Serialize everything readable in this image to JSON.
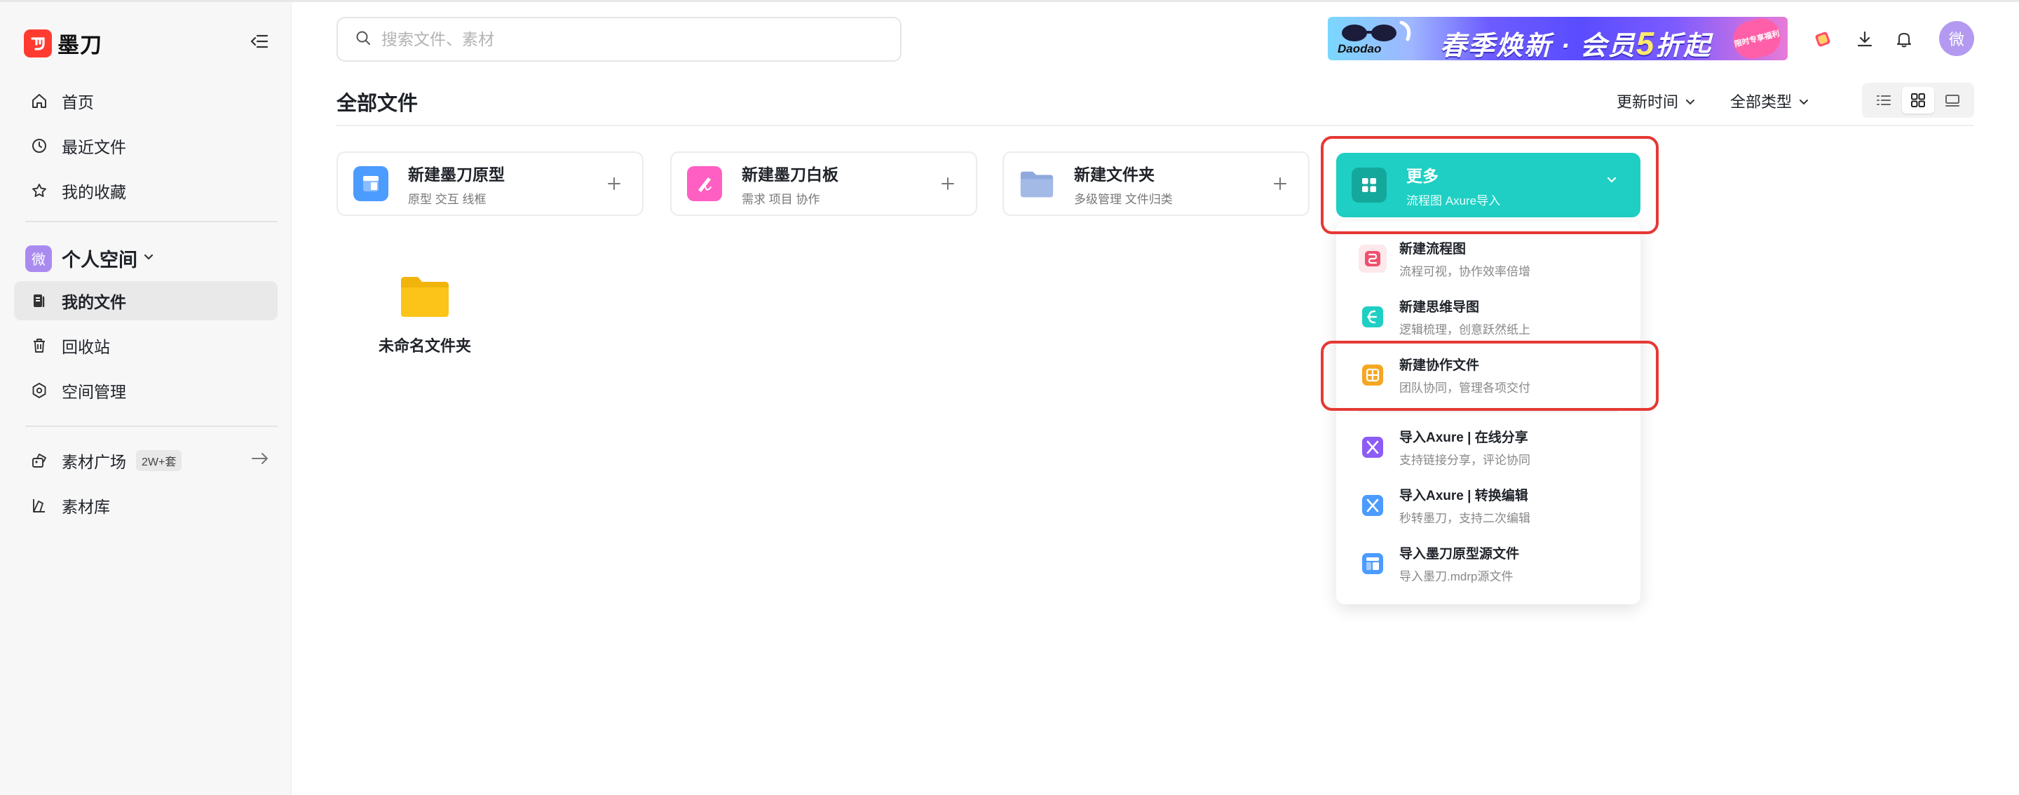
{
  "app": {
    "logo_text": "墨刀",
    "accent": "#ff3b30"
  },
  "sidebar": {
    "nav_primary": [
      {
        "label": "首页",
        "icon": "home-icon"
      },
      {
        "label": "最近文件",
        "icon": "clock-icon"
      },
      {
        "label": "我的收藏",
        "icon": "star-icon"
      }
    ],
    "space": {
      "avatar": "微",
      "title": "个人空间",
      "avatar_color": "#a98bf0"
    },
    "nav_space": [
      {
        "label": "我的文件",
        "icon": "file-icon",
        "active": true
      },
      {
        "label": "回收站",
        "icon": "trash-icon"
      },
      {
        "label": "空间管理",
        "icon": "settings-icon"
      }
    ],
    "nav_assets": [
      {
        "label": "素材广场",
        "icon": "assets-icon",
        "badge": "2W+套"
      },
      {
        "label": "素材库",
        "icon": "library-icon"
      }
    ]
  },
  "header": {
    "search_placeholder": "搜索文件、素材",
    "banner": {
      "brand": "Daodao",
      "headline_a": "春季焕新 · 会员",
      "headline_num": "5",
      "headline_b": "折起",
      "sticker": "限时专享福利"
    },
    "user_avatar": "微"
  },
  "toolbar": {
    "title": "全部文件",
    "sort_label": "更新时间",
    "type_label": "全部类型"
  },
  "create_cards": [
    {
      "title": "新建墨刀原型",
      "subtitle": "原型 交互 线框",
      "icon": "prototype-icon",
      "color": "#4c9bff"
    },
    {
      "title": "新建墨刀白板",
      "subtitle": "需求 项目 协作",
      "icon": "whiteboard-icon",
      "color": "#ff5fc3"
    },
    {
      "title": "新建文件夹",
      "subtitle": "多级管理 文件归类",
      "icon": "folder-icon",
      "color": "#8fa9dd"
    }
  ],
  "more_card": {
    "title": "更多",
    "subtitle": "流程图 Axure导入",
    "color": "#1fcfc3"
  },
  "menu": {
    "items": [
      {
        "title": "新建流程图",
        "subtitle": "流程可视，协作效率倍增",
        "icon": "flowchart-icon",
        "color": "#f0506e"
      },
      {
        "title": "新建思维导图",
        "subtitle": "逻辑梳理，创意跃然纸上",
        "icon": "mindmap-icon",
        "color": "#1fcfc3"
      },
      {
        "title": "新建协作文件",
        "subtitle": "团队协同，管理各项交付",
        "icon": "collab-icon",
        "color": "#f5a623"
      },
      {
        "title": "导入Axure | 在线分享",
        "subtitle": "支持链接分享，评论协同",
        "icon": "axure-share-icon",
        "color": "#8b5cf6"
      },
      {
        "title": "导入Axure | 转换编辑",
        "subtitle": "秒转墨刀，支持二次编辑",
        "icon": "axure-convert-icon",
        "color": "#4c9bff"
      },
      {
        "title": "导入墨刀原型源文件",
        "subtitle": "导入墨刀.mdrp源文件",
        "icon": "mdrp-icon",
        "color": "#4c9bff"
      }
    ]
  },
  "files": [
    {
      "name": "未命名文件夹",
      "icon": "folder-icon",
      "color": "#fcc419"
    }
  ],
  "highlight_color": "#e53935"
}
